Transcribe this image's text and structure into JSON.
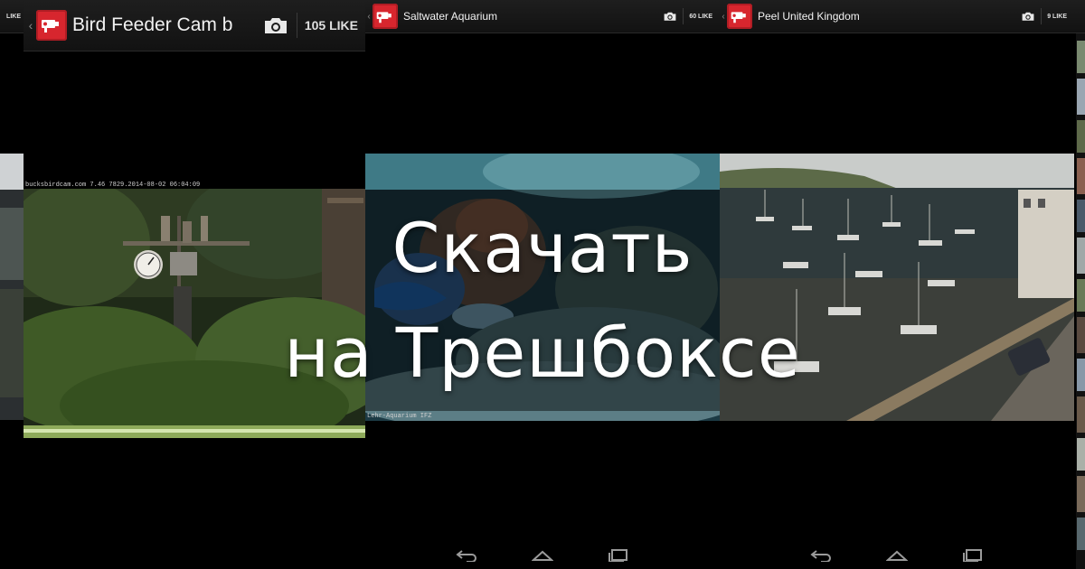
{
  "panels": [
    {
      "id": "left-edge",
      "likes_label": "LIKE"
    },
    {
      "id": "bird-feeder",
      "title": "Bird Feeder Cam b",
      "likes_label": "105 LIKE",
      "stream_caption": "bucksbirdcam.com   7.46  7829.2014-08-02 06:04:09"
    },
    {
      "id": "saltwater",
      "title": "Saltwater Aquarium",
      "likes_label": "60 LIKE",
      "stream_caption": "Lehr-Aquarium IFZ"
    },
    {
      "id": "peel",
      "title": "Peel United Kingdom",
      "likes_label": "9 LIKE"
    }
  ],
  "promo": {
    "line1": "Скачать",
    "line2": "на Трешбоксе"
  },
  "colors": {
    "accent_red": "#d7262e",
    "actionbar": "#151515",
    "background": "#000000"
  },
  "icons": [
    "webcam-app-icon",
    "camera-icon",
    "back-chevron-icon",
    "back-nav-icon",
    "home-nav-icon",
    "recents-nav-icon"
  ]
}
